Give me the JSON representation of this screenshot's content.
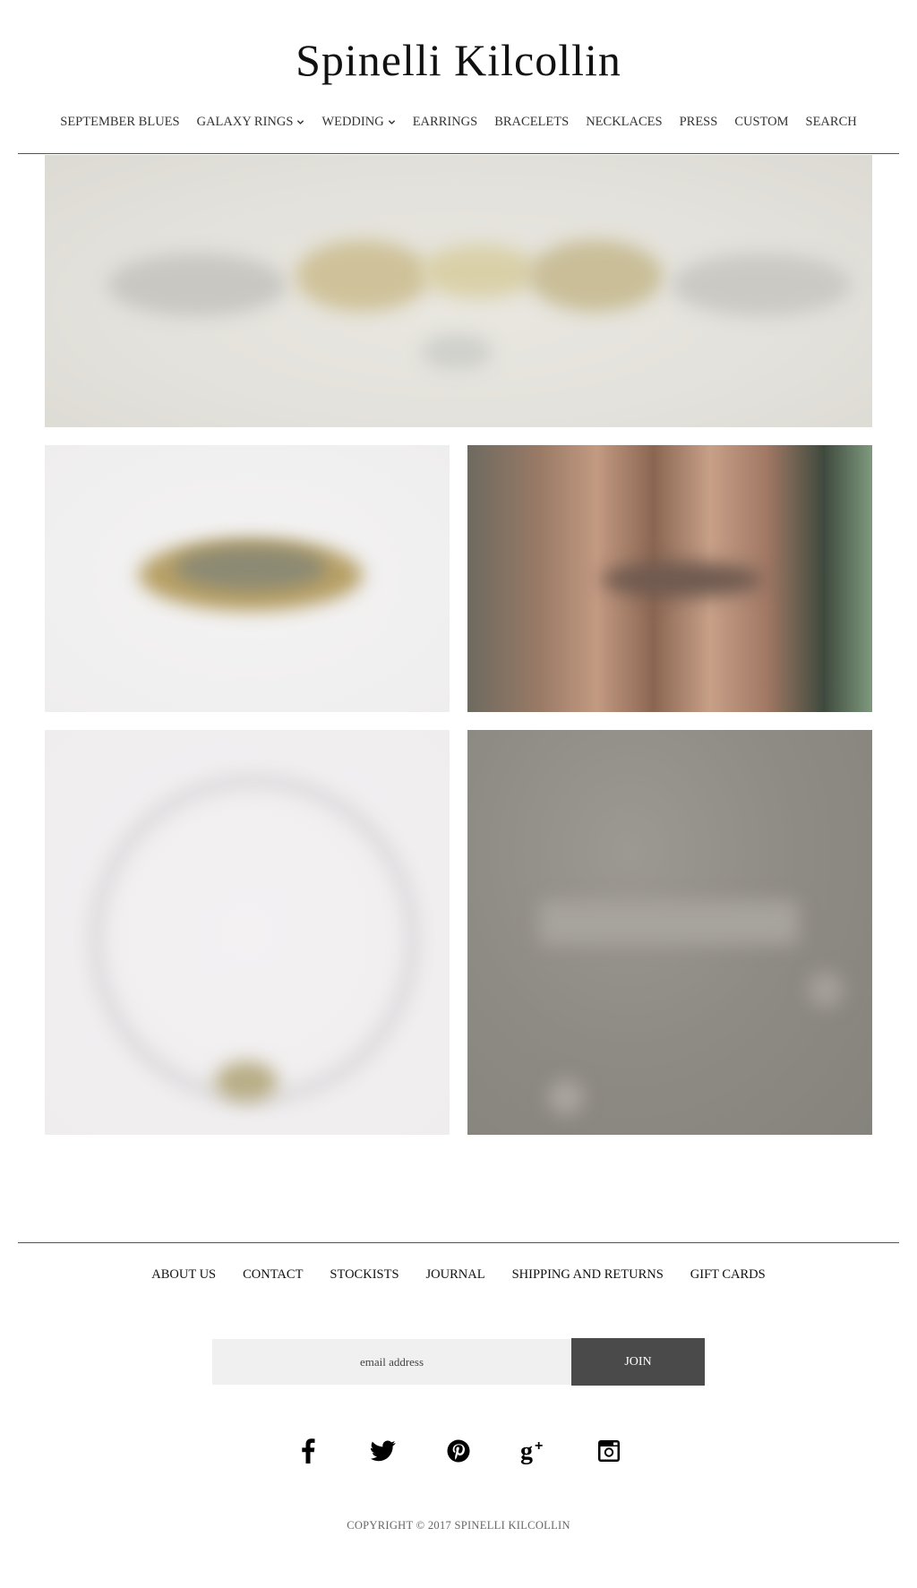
{
  "header": {
    "title": "Spinelli Kilcollin"
  },
  "nav": {
    "items": [
      {
        "label": "SEPTEMBER BLUES",
        "has_dropdown": false
      },
      {
        "label": "GALAXY RINGS",
        "has_dropdown": true
      },
      {
        "label": "WEDDING",
        "has_dropdown": true
      },
      {
        "label": "EARRINGS",
        "has_dropdown": false
      },
      {
        "label": "BRACELETS",
        "has_dropdown": false
      },
      {
        "label": "NECKLACES",
        "has_dropdown": false
      },
      {
        "label": "PRESS",
        "has_dropdown": false
      },
      {
        "label": "CUSTOM",
        "has_dropdown": false
      },
      {
        "label": "SEARCH",
        "has_dropdown": false
      }
    ]
  },
  "footer": {
    "links": [
      "ABOUT US",
      "CONTACT",
      "STOCKISTS",
      "JOURNAL",
      "SHIPPING AND RETURNS",
      "GIFT CARDS"
    ],
    "newsletter": {
      "placeholder": "email address",
      "button_label": "JOIN"
    },
    "social": [
      "facebook-icon",
      "twitter-icon",
      "pinterest-icon",
      "google-plus-icon",
      "instagram-icon"
    ],
    "copyright": "COPYRIGHT © 2017 SPINELLI KILCOLLIN"
  },
  "colors": {
    "button_bg": "#4a4a4a",
    "input_bg": "#f0f0f0",
    "rule": "#555555"
  }
}
